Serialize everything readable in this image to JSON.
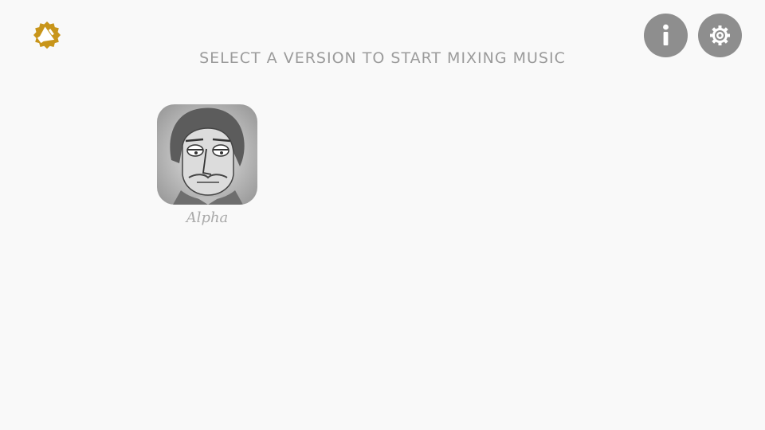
{
  "header": {
    "title": "SELECT A VERSION TO START MIXING MUSIC"
  },
  "top_buttons": {
    "badge_icon": "megaphone-badge-icon",
    "info_icon": "info-icon",
    "settings_icon": "gear-icon"
  },
  "versions": [
    {
      "label": "Alpha",
      "icon": "character-face-icon"
    }
  ],
  "colors": {
    "background": "#f9f9f9",
    "button_gray": "#8e8e8e",
    "badge_gold": "#c8951a",
    "text_gray": "#9b9b9b"
  }
}
